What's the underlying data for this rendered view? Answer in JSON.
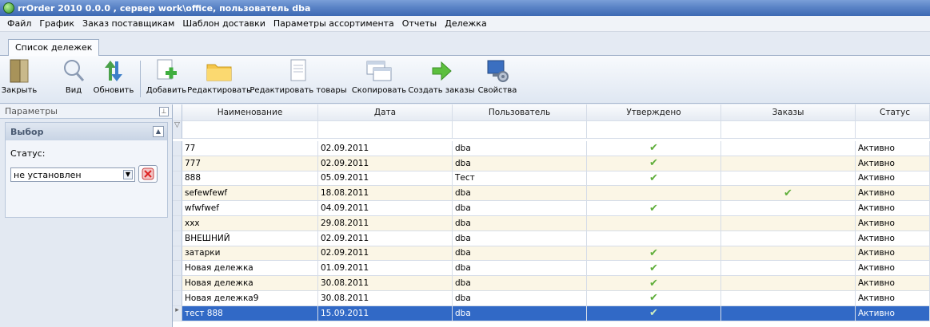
{
  "window": {
    "title": "rrOrder 2010 0.0.0 , сервер work\\office, пользователь dba"
  },
  "menu": [
    "Файл",
    "График",
    "Заказ поставщикам",
    "Шаблон доставки",
    "Параметры ассортимента",
    "Отчеты",
    "Дележка"
  ],
  "tab": {
    "label": "Список дележек"
  },
  "toolbar": {
    "close": "Закрыть",
    "view": "Вид",
    "refresh": "Обновить",
    "add": "Добавить",
    "edit": "Редактировать",
    "edit_goods": "Редактировать товары",
    "copy": "Скопировать",
    "create_orders": "Создать заказы",
    "properties": "Свойства"
  },
  "panel": {
    "title": "Параметры",
    "group_title": "Выбор",
    "status_label": "Статус:",
    "status_value": "не установлен"
  },
  "grid": {
    "columns": [
      "Наименование",
      "Дата",
      "Пользователь",
      "Утверждено",
      "Заказы",
      "Статус"
    ],
    "rows": [
      {
        "name": "77",
        "date": "02.09.2011",
        "user": "dba",
        "approved": "✔",
        "orders": "",
        "status": "Активно"
      },
      {
        "name": "777",
        "date": "02.09.2011",
        "user": "dba",
        "approved": "✔",
        "orders": "",
        "status": "Активно"
      },
      {
        "name": "888",
        "date": "05.09.2011",
        "user": "Тест",
        "approved": "✔",
        "orders": "",
        "status": "Активно"
      },
      {
        "name": "sefewfewf",
        "date": "18.08.2011",
        "user": "dba",
        "approved": "",
        "orders": "✔",
        "status": "Активно"
      },
      {
        "name": "wfwfwef",
        "date": "04.09.2011",
        "user": "dba",
        "approved": "✔",
        "orders": "",
        "status": "Активно"
      },
      {
        "name": "xxx",
        "date": "29.08.2011",
        "user": "dba",
        "approved": "",
        "orders": "",
        "status": "Активно"
      },
      {
        "name": "ВНЕШНИЙ",
        "date": "02.09.2011",
        "user": "dba",
        "approved": "",
        "orders": "",
        "status": "Активно"
      },
      {
        "name": "затарки",
        "date": "02.09.2011",
        "user": "dba",
        "approved": "✔",
        "orders": "",
        "status": "Активно"
      },
      {
        "name": "Новая дележка",
        "date": "01.09.2011",
        "user": "dba",
        "approved": "✔",
        "orders": "",
        "status": "Активно"
      },
      {
        "name": "Новая дележка",
        "date": "30.08.2011",
        "user": "dba",
        "approved": "✔",
        "orders": "",
        "status": "Активно"
      },
      {
        "name": "Новая дележка9",
        "date": "30.08.2011",
        "user": "dba",
        "approved": "✔",
        "orders": "",
        "status": "Активно"
      },
      {
        "name": "тест 888",
        "date": "15.09.2011",
        "user": "dba",
        "approved": "✔",
        "orders": "",
        "status": "Активно"
      }
    ]
  }
}
